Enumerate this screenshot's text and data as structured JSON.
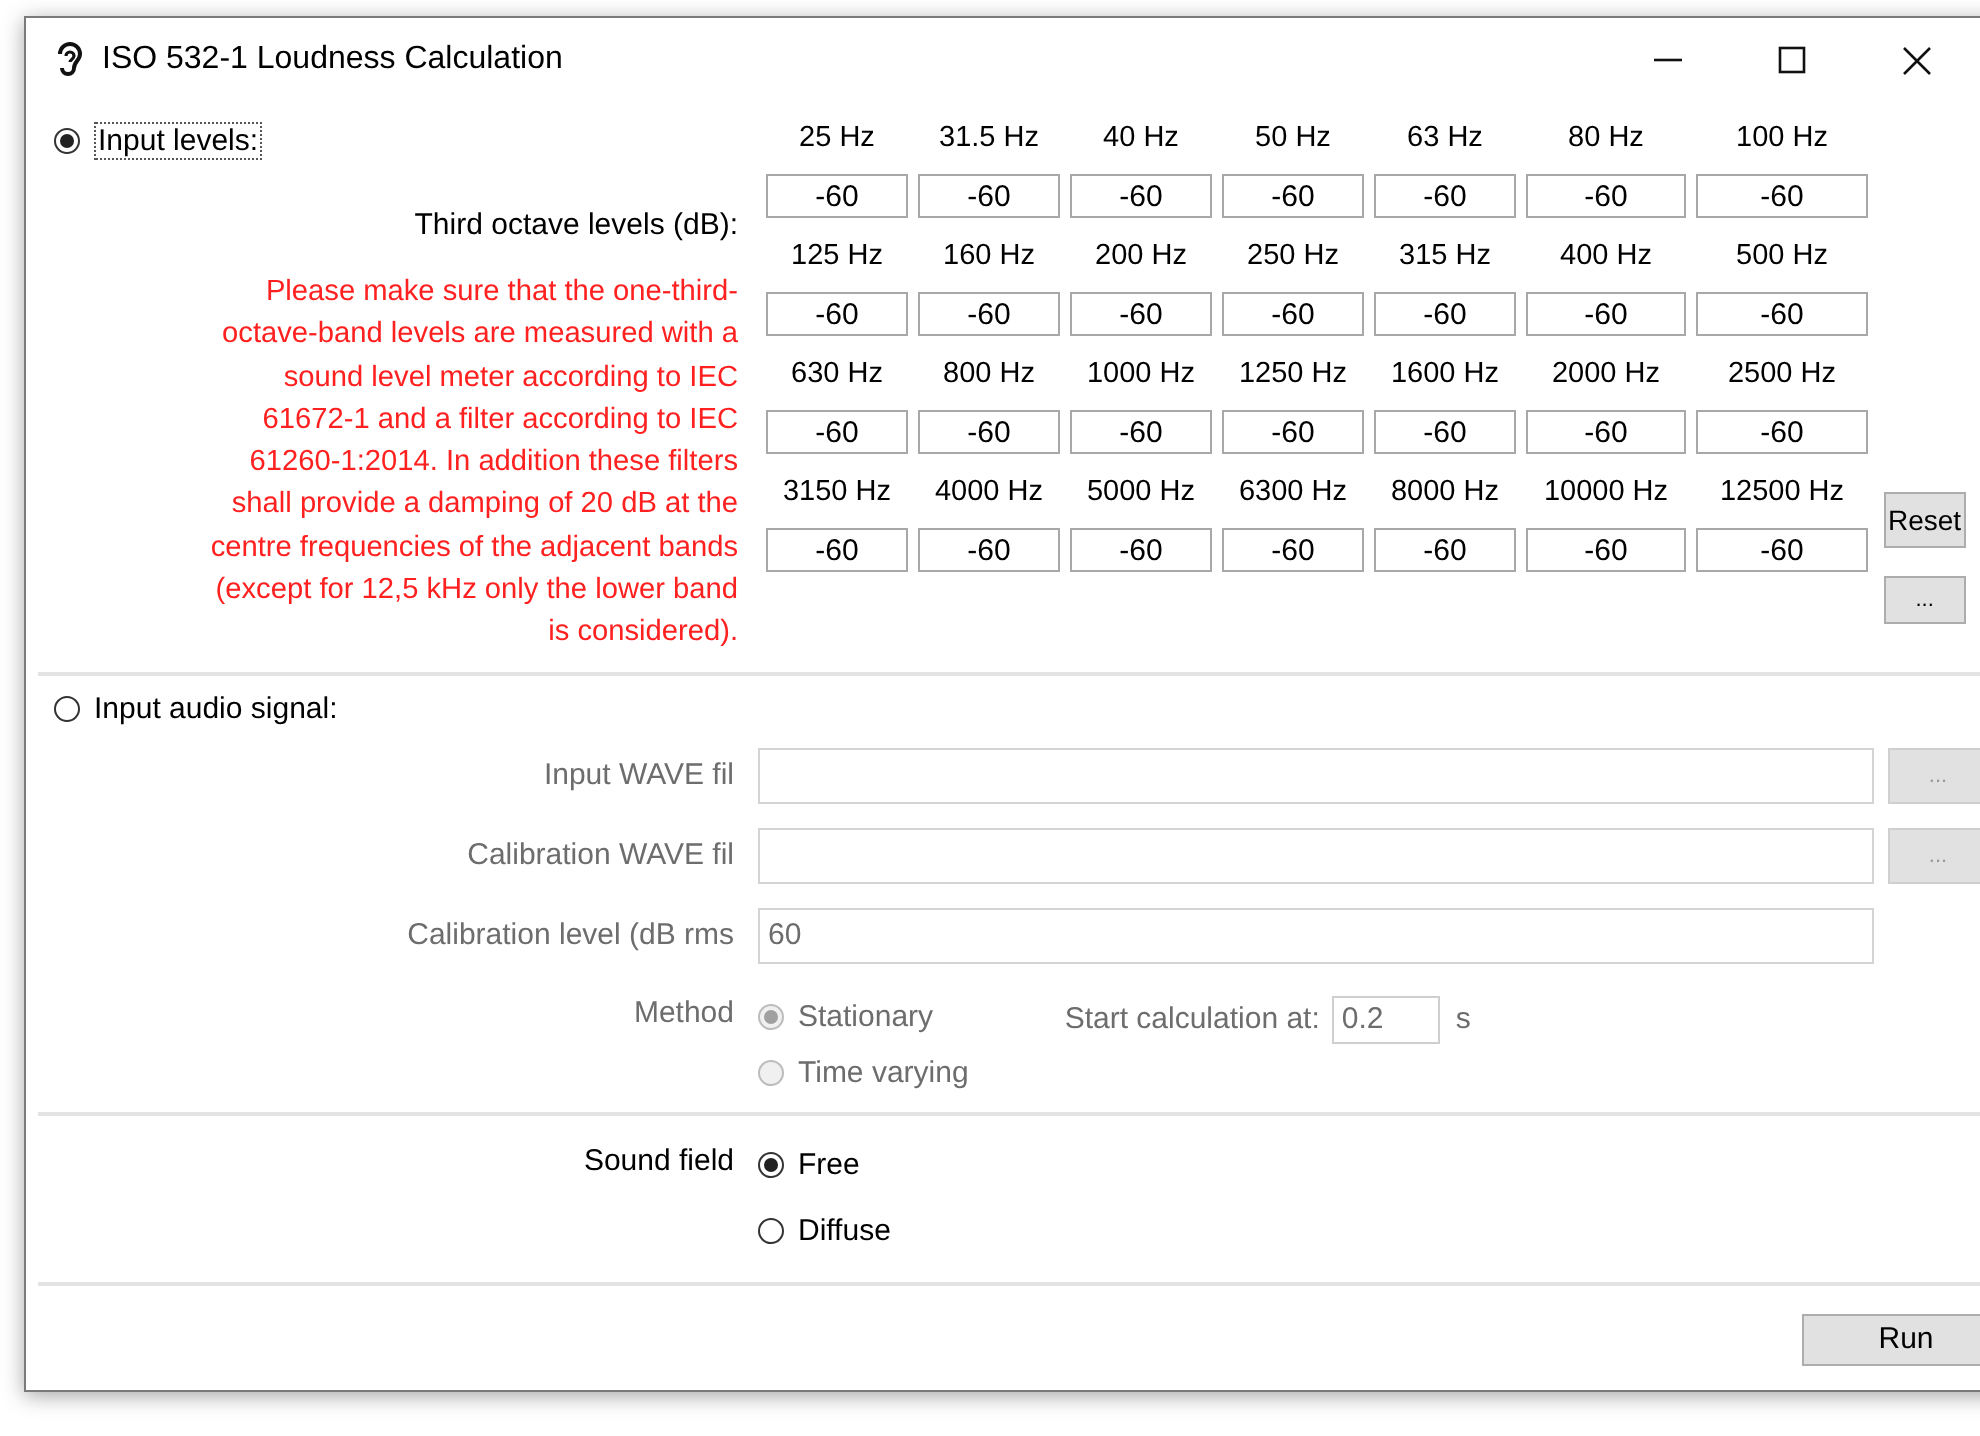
{
  "window": {
    "title": "ISO 532-1 Loudness Calculation",
    "controls": [
      {
        "kind": "minimize"
      },
      {
        "kind": "maximize"
      },
      {
        "kind": "close"
      }
    ]
  },
  "input_levels": {
    "label": "Input levels:",
    "selected": true,
    "levels_label": "Third octave levels (dB):",
    "warning_lines": [
      "Please make sure that the one-third-",
      "octave-band levels are measured with a",
      "sound level meter according to IEC",
      "61672-1 and a filter according to IEC",
      "61260-1:2014. In addition these filters",
      "shall provide a damping of 20 dB at the",
      "centre frequencies of the adjacent bands",
      "(except for 12,5 kHz only the lower band",
      "is considered)."
    ],
    "bands": [
      {
        "freq": "25 Hz",
        "value": "-60"
      },
      {
        "freq": "31.5 Hz",
        "value": "-60"
      },
      {
        "freq": "40 Hz",
        "value": "-60"
      },
      {
        "freq": "50 Hz",
        "value": "-60"
      },
      {
        "freq": "63 Hz",
        "value": "-60"
      },
      {
        "freq": "80 Hz",
        "value": "-60"
      },
      {
        "freq": "100 Hz",
        "value": "-60"
      },
      {
        "freq": "125 Hz",
        "value": "-60"
      },
      {
        "freq": "160 Hz",
        "value": "-60"
      },
      {
        "freq": "200 Hz",
        "value": "-60"
      },
      {
        "freq": "250 Hz",
        "value": "-60"
      },
      {
        "freq": "315 Hz",
        "value": "-60"
      },
      {
        "freq": "400 Hz",
        "value": "-60"
      },
      {
        "freq": "500 Hz",
        "value": "-60"
      },
      {
        "freq": "630 Hz",
        "value": "-60"
      },
      {
        "freq": "800 Hz",
        "value": "-60"
      },
      {
        "freq": "1000 Hz",
        "value": "-60"
      },
      {
        "freq": "1250 Hz",
        "value": "-60"
      },
      {
        "freq": "1600 Hz",
        "value": "-60"
      },
      {
        "freq": "2000 Hz",
        "value": "-60"
      },
      {
        "freq": "2500 Hz",
        "value": "-60"
      },
      {
        "freq": "3150 Hz",
        "value": "-60"
      },
      {
        "freq": "4000 Hz",
        "value": "-60"
      },
      {
        "freq": "5000 Hz",
        "value": "-60"
      },
      {
        "freq": "6300 Hz",
        "value": "-60"
      },
      {
        "freq": "8000 Hz",
        "value": "-60"
      },
      {
        "freq": "10000 Hz",
        "value": "-60"
      },
      {
        "freq": "12500 Hz",
        "value": "-60"
      }
    ],
    "buttons": [
      "Reset",
      "..."
    ]
  },
  "audio_signal": {
    "label": "Input audio signal:",
    "selected": false,
    "disabled": true,
    "files": [
      {
        "label": "Input WAVE fil",
        "browse": "..."
      },
      {
        "label": "Calibration WAVE fil",
        "browse": "..."
      }
    ],
    "calibration_level": {
      "label": "Calibration level (dB rms",
      "value": "60"
    },
    "method": {
      "label": "Method",
      "options": [
        {
          "label": "Stationary",
          "selected": true
        },
        {
          "label": "Time varying",
          "selected": false
        }
      ],
      "start_label": "Start calculation at:",
      "start_value": "0.2",
      "unit": "s"
    }
  },
  "sound_field": {
    "label": "Sound field",
    "options": [
      {
        "label": "Free",
        "selected": true
      },
      {
        "label": "Diffuse",
        "selected": false
      }
    ]
  },
  "run_button": "Run"
}
